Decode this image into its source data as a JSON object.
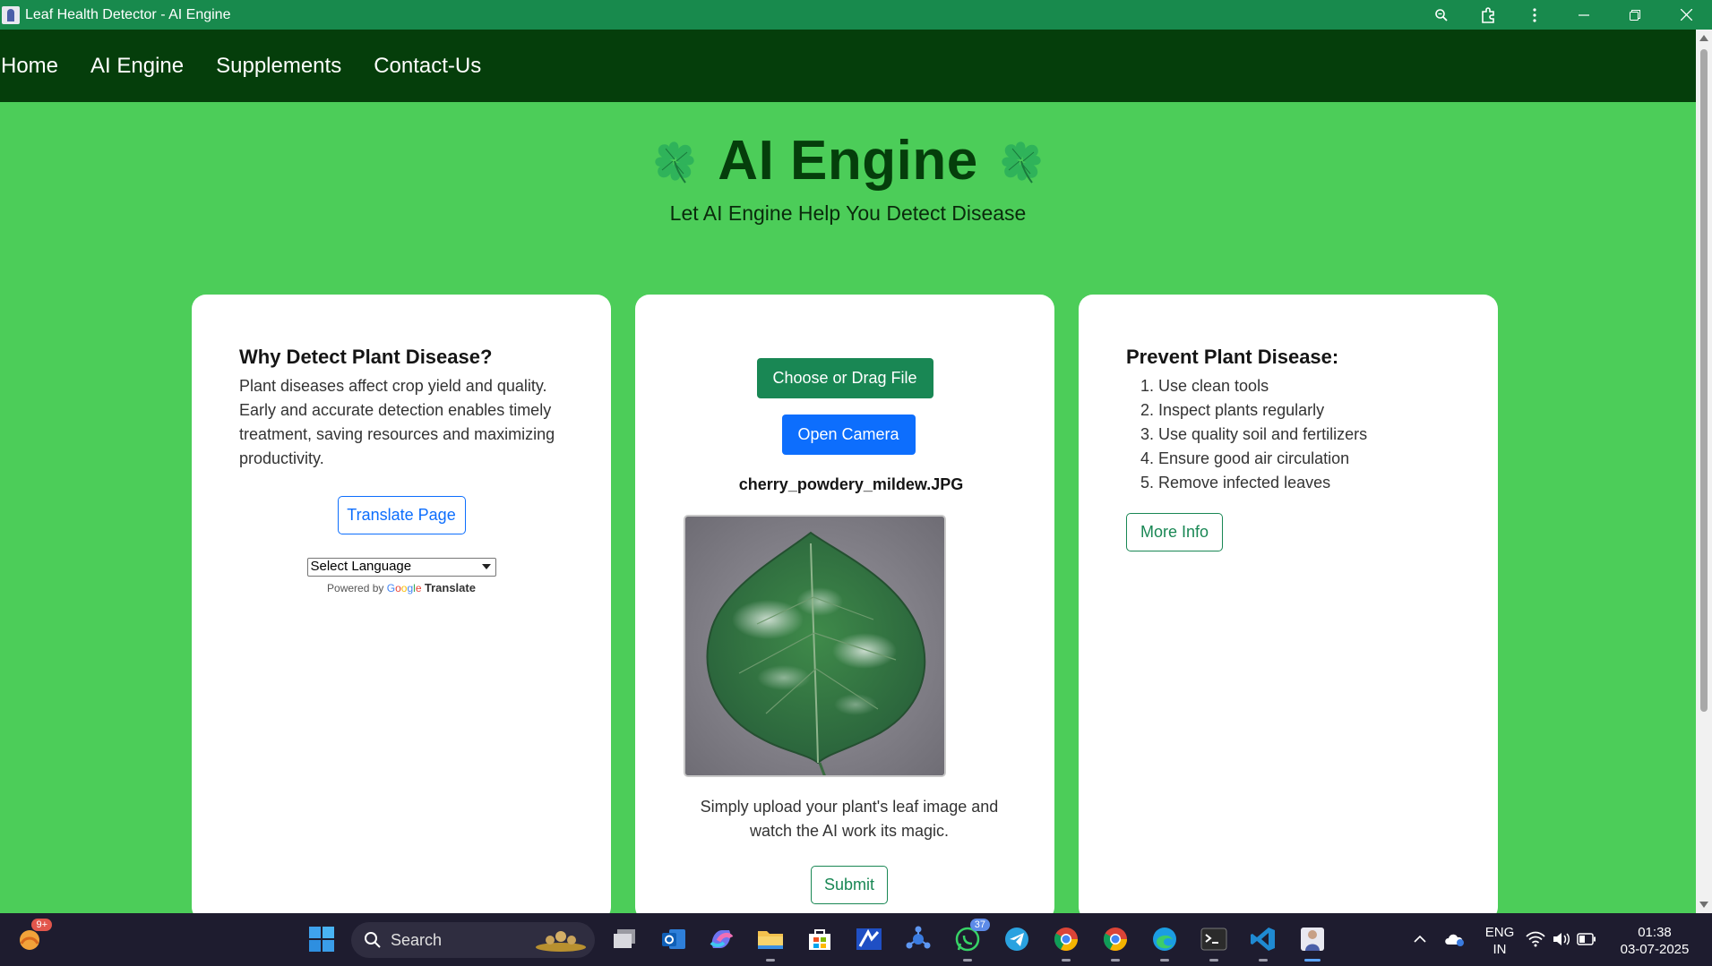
{
  "window": {
    "title": "Leaf Health Detector - AI Engine"
  },
  "nav": {
    "items": [
      {
        "label": "Home"
      },
      {
        "label": "AI Engine"
      },
      {
        "label": "Supplements"
      },
      {
        "label": "Contact-Us"
      }
    ]
  },
  "hero": {
    "title": "AI Engine",
    "subtitle": "Let AI Engine Help You Detect Disease",
    "emoji_icon": "four-leaf-clover-icon"
  },
  "left_card": {
    "heading": "Why Detect Plant Disease?",
    "body": "Plant diseases affect crop yield and quality. Early and accurate detection enables timely treatment, saving resources and maximizing productivity.",
    "translate_button": "Translate Page",
    "language_select": "Select Language",
    "powered_by": "Powered by",
    "google_letters": [
      "G",
      "o",
      "o",
      "g",
      "l",
      "e"
    ],
    "translate_word": "Translate"
  },
  "middle_card": {
    "choose_button": "Choose or Drag File",
    "camera_button": "Open Camera",
    "filename": "cherry_powdery_mildew.JPG",
    "caption": "Simply upload your plant's leaf image and watch the AI work its magic.",
    "submit_button": "Submit"
  },
  "right_card": {
    "heading": "Prevent Plant Disease:",
    "tips": [
      "Use clean tools",
      "Inspect plants regularly",
      "Use quality soil and fertilizers",
      "Ensure good air circulation",
      "Remove infected leaves"
    ],
    "more_button": "More Info"
  },
  "colors": {
    "page_bg": "#4ccd59",
    "nav_bg": "#053e0b",
    "titlebar_bg": "#188a4d",
    "primary_green": "#198754",
    "primary_blue": "#0d6efd"
  },
  "taskbar": {
    "search_label": "Search",
    "widgets_badge": "9+",
    "whatsapp_badge": "37",
    "language_line1": "ENG",
    "language_line2": "IN",
    "time": "01:38",
    "date": "03-07-2025"
  }
}
